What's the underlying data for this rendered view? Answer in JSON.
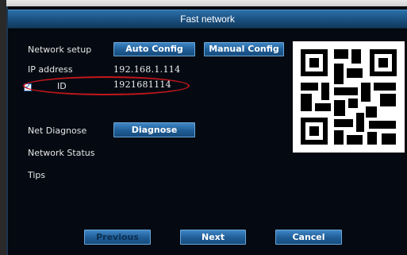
{
  "window": {
    "title": "Fast network"
  },
  "network_setup": {
    "label": "Network setup",
    "auto_config": "Auto Config",
    "manual_config": "Manual Config"
  },
  "ip": {
    "label": "IP address",
    "value": "192.168.1.114"
  },
  "id": {
    "label": "ID",
    "value": "1921681114",
    "checked": true
  },
  "diagnose": {
    "label": "Net Diagnose",
    "button": "Diagnose"
  },
  "network_status": {
    "label": "Network Status"
  },
  "tips": {
    "label": "Tips"
  },
  "footer": {
    "previous": "Previous",
    "next": "Next",
    "cancel": "Cancel"
  },
  "colors": {
    "title_bar": "#1a4f7e",
    "button": "#1f5d96",
    "highlight": "#c4161c",
    "background": "#05080e"
  }
}
